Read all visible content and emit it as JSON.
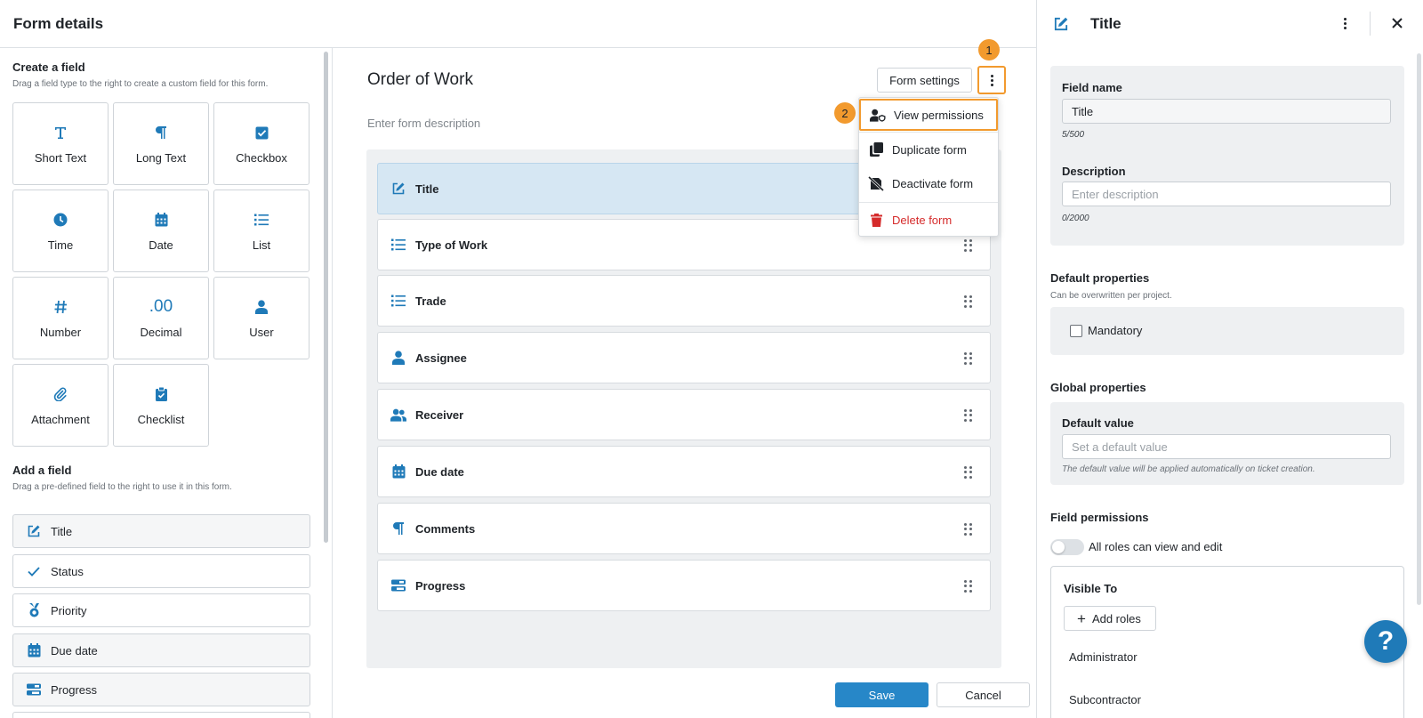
{
  "header": {
    "title": "Form details"
  },
  "create_field": {
    "title": "Create a field",
    "subtitle": "Drag a field type to the right to create a custom field for this form.",
    "types": [
      {
        "label": "Short Text",
        "icon": "text-icon"
      },
      {
        "label": "Long Text",
        "icon": "paragraph-icon"
      },
      {
        "label": "Checkbox",
        "icon": "checkbox-icon"
      },
      {
        "label": "Time",
        "icon": "clock-icon"
      },
      {
        "label": "Date",
        "icon": "calendar-icon"
      },
      {
        "label": "List",
        "icon": "list-icon"
      },
      {
        "label": "Number",
        "icon": "hash-icon"
      },
      {
        "label": "Decimal",
        "icon": "decimal-icon",
        "glyph": ".00"
      },
      {
        "label": "User",
        "icon": "user-icon"
      },
      {
        "label": "Attachment",
        "icon": "paperclip-icon"
      },
      {
        "label": "Checklist",
        "icon": "clipboard-check-icon"
      }
    ]
  },
  "add_field": {
    "title": "Add a field",
    "subtitle": "Drag a pre-defined field to the right to use it in this form.",
    "fields": [
      {
        "label": "Title",
        "icon": "edit-icon"
      },
      {
        "label": "Status",
        "icon": "check-icon"
      },
      {
        "label": "Priority",
        "icon": "medal-icon"
      },
      {
        "label": "Due date",
        "icon": "calendar-icon"
      },
      {
        "label": "Progress",
        "icon": "progress-icon"
      }
    ]
  },
  "form": {
    "title": "Order of Work",
    "description_placeholder": "Enter form description",
    "settings_label": "Form settings",
    "badges": [
      "1",
      "2"
    ],
    "fields": [
      {
        "label": "Title",
        "icon": "edit-icon",
        "active": true
      },
      {
        "label": "Type of Work",
        "icon": "list-icon"
      },
      {
        "label": "Trade",
        "icon": "list-icon"
      },
      {
        "label": "Assignee",
        "icon": "user-icon"
      },
      {
        "label": "Receiver",
        "icon": "users-icon"
      },
      {
        "label": "Due date",
        "icon": "calendar-icon"
      },
      {
        "label": "Comments",
        "icon": "paragraph-icon"
      },
      {
        "label": "Progress",
        "icon": "progress-icon"
      }
    ],
    "save_label": "Save",
    "cancel_label": "Cancel"
  },
  "menu": {
    "items": [
      {
        "label": "View permissions",
        "icon": "user-shield-icon"
      },
      {
        "label": "Duplicate form",
        "icon": "copy-icon"
      },
      {
        "label": "Deactivate form",
        "icon": "deactivate-icon"
      },
      {
        "label": "Delete form",
        "icon": "trash-icon"
      }
    ]
  },
  "details": {
    "title": "Title",
    "field_name_label": "Field name",
    "field_name_value": "Title",
    "field_name_counter": "5/500",
    "description_label": "Description",
    "description_placeholder": "Enter description",
    "description_counter": "0/2000",
    "default_props_title": "Default properties",
    "default_props_sub": "Can be overwritten per project.",
    "mandatory_label": "Mandatory",
    "global_props_title": "Global properties",
    "default_value_label": "Default value",
    "default_value_placeholder": "Set a default value",
    "default_value_note": "The default value will be applied automatically on ticket creation.",
    "permissions_title": "Field permissions",
    "permissions_toggle_label": "All roles can view and edit",
    "visible_to_label": "Visible To",
    "add_roles_label": "Add roles",
    "roles": [
      "Administrator",
      "Subcontractor"
    ]
  },
  "help": {
    "label": "?"
  },
  "colors": {
    "accent": "#1f7ab8",
    "primary_button": "#2787c8",
    "highlight": "#f29a2e",
    "danger": "#d52b2b",
    "active_row": "#d6e7f3"
  }
}
